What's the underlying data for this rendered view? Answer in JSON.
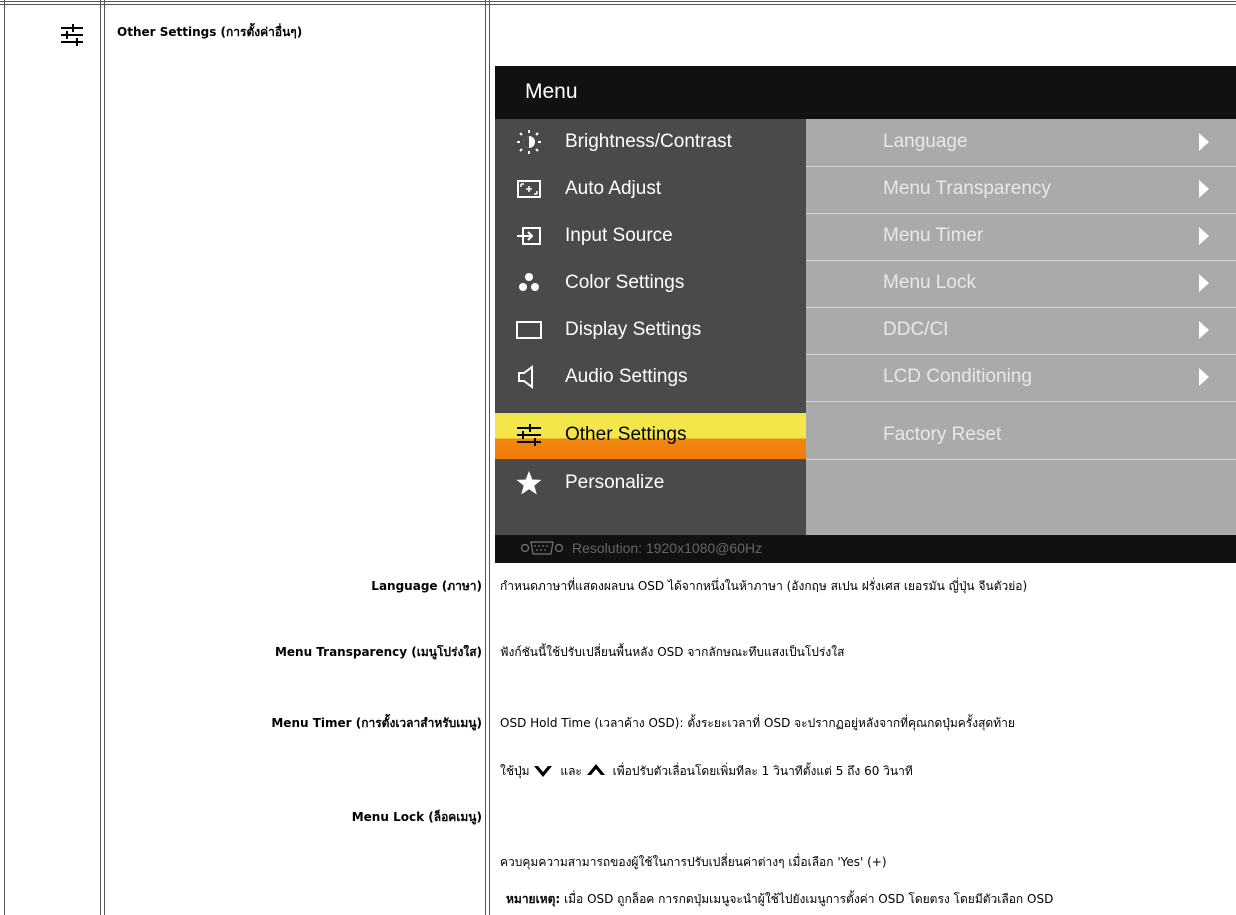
{
  "section": {
    "title": "Other Settings (การตั้งค่าอื่นๆ)",
    "icon": "sliders-icon"
  },
  "osd": {
    "title": "Menu",
    "menu_items": [
      {
        "label": "Brightness/Contrast",
        "icon": "brightness-icon"
      },
      {
        "label": "Auto Adjust",
        "icon": "auto-adjust-icon"
      },
      {
        "label": "Input Source",
        "icon": "input-source-icon"
      },
      {
        "label": "Color Settings",
        "icon": "color-settings-icon"
      },
      {
        "label": "Display Settings",
        "icon": "display-settings-icon"
      },
      {
        "label": "Audio Settings",
        "icon": "speaker-icon"
      },
      {
        "label": "Other Settings",
        "icon": "sliders-icon",
        "selected": true
      },
      {
        "label": "Personalize",
        "icon": "star-icon"
      }
    ],
    "sub_items": [
      {
        "label": "Language",
        "arrow": true
      },
      {
        "label": "Menu Transparency",
        "arrow": true
      },
      {
        "label": "Menu Timer",
        "arrow": true
      },
      {
        "label": "Menu Lock",
        "arrow": true
      },
      {
        "label": "DDC/CI",
        "arrow": true
      },
      {
        "label": "LCD Conditioning",
        "arrow": true
      },
      {
        "label": "Factory Reset",
        "arrow": false
      }
    ],
    "resolution": "Resolution:  1920x1080@60Hz",
    "colors": {
      "selected_top": "#f2e64a",
      "selected_bottom": "#f07a0a",
      "left_panel": "#4a4a4a",
      "right_panel": "#aaaaaa"
    }
  },
  "rows": {
    "language": {
      "label": "Language (ภาษา)",
      "desc": "กำหนดภาษาที่แสดงผลบน OSD ได้จากหนึ่งในห้าภาษา (อังกฤษ สเปน ฝรั่งเศส เยอรมัน ญี่ปุ่น จีนตัวย่อ)"
    },
    "transparency": {
      "label": "Menu Transparency (เมนูโปร่งใส)",
      "desc": "ฟังก์ชันนี้ใช้ปรับเปลี่ยนพื้นหลัง OSD จากลักษณะทึบแสงเป็นโปร่งใส"
    },
    "timer": {
      "label": "Menu Timer (การตั้งเวลาสำหรับเมนู)",
      "desc1": "OSD Hold Time (เวลาค้าง OSD): ตั้งระยะเวลาที่ OSD จะปรากฏอยู่หลังจากที่คุณกดปุ่มครั้งสุดท้าย",
      "desc2_a": "ใช้ปุ่ม",
      "desc2_down": "⌄",
      "desc2_b": "และ",
      "desc2_up": "⌃",
      "desc2_c": "เพื่อปรับตัวเลื่อนโดยเพิ่มทีละ 1 วินาทีตั้งแต่ 5 ถึง 60 วินาที"
    },
    "lock": {
      "label": "Menu Lock (ล็อคเมนู)",
      "desc": "ควบคุมความสามารถของผู้ใช้ในการปรับเปลี่ยนค่าต่างๆ เมื่อเลือก 'Yes' (+)",
      "note_label": "หมายเหตุ:",
      "note": "เมื่อ OSD ถูกล็อค การกดปุ่มเมนูจะนำผู้ใช้ไปยังเมนูการตั้งค่า OSD โดยตรง โดยมีตัวเลือก OSD"
    }
  }
}
